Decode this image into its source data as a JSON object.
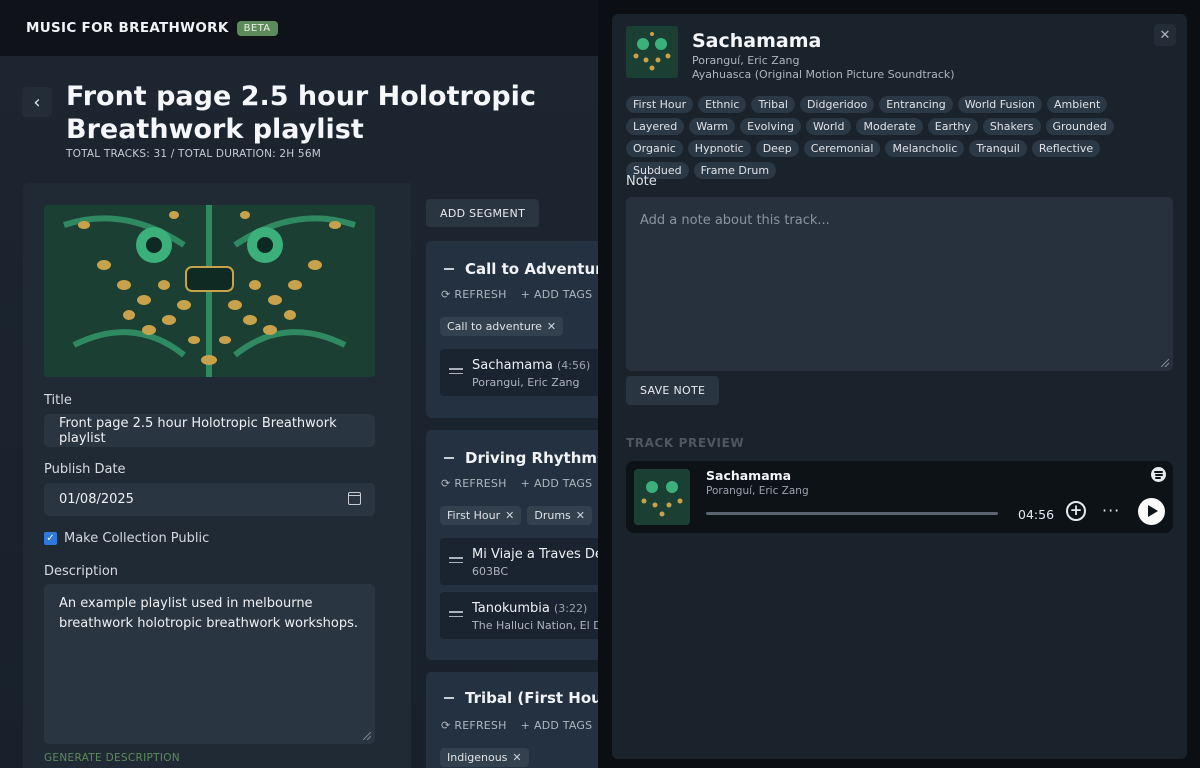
{
  "app": {
    "brand": "MUSIC FOR BREATHWORK",
    "badge": "BETA"
  },
  "page": {
    "title": "Front page 2.5 hour Holotropic Breathwork playlist",
    "meta": "TOTAL TRACKS: 31 /  TOTAL DURATION: 2H 56M"
  },
  "form": {
    "title_label": "Title",
    "title_value": "Front page 2.5 hour Holotropic Breathwork playlist",
    "date_label": "Publish Date",
    "date_value": "01/08/2025",
    "public_label": "Make Collection Public",
    "description_label": "Description",
    "description_value": "An example playlist used in melbourne breathwork holotropic breathwork workshops.",
    "generate_label": "GENERATE DESCRIPTION"
  },
  "segments": {
    "add_label": "ADD SEGMENT",
    "refresh_label": "REFRESH",
    "add_tags_label": "ADD TAGS",
    "items": [
      {
        "title": "Call to Adventure",
        "chips": [
          "Call to adventure"
        ],
        "tracks": [
          {
            "name": "Sachamama",
            "duration": "(4:56)",
            "artist": "Porangui, Eric Zang"
          }
        ]
      },
      {
        "title": "Driving Rhythms (F",
        "chips": [
          "First Hour",
          "Drums"
        ],
        "tracks": [
          {
            "name": "Mi Viaje a Traves De l",
            "duration": "",
            "artist": "603BC"
          },
          {
            "name": "Tanokumbia",
            "duration": "(3:22)",
            "artist": "The Halluci Nation, El Dus"
          }
        ]
      },
      {
        "title": "Tribal (First Hour)",
        "chips": [
          "Indigenous"
        ],
        "tracks": []
      }
    ]
  },
  "drawer": {
    "title": "Sachamama",
    "artist": "Poranguí, Eric Zang",
    "album": "Ayahuasca (Original Motion Picture Soundtrack)",
    "close_label": "✕",
    "tags": [
      "First Hour",
      "Ethnic",
      "Tribal",
      "Didgeridoo",
      "Entrancing",
      "World Fusion",
      "Ambient",
      "Layered",
      "Warm",
      "Evolving",
      "World",
      "Moderate",
      "Earthy",
      "Shakers",
      "Grounded",
      "Organic",
      "Hypnotic",
      "Deep",
      "Ceremonial",
      "Melancholic",
      "Tranquil",
      "Reflective",
      "Subdued",
      "Frame Drum"
    ],
    "note_label": "Note",
    "note_placeholder": "Add a note about this track...",
    "save_label": "SAVE NOTE",
    "preview_label": "TRACK PREVIEW",
    "player": {
      "title": "Sachamama",
      "artist": "Poranguí, Eric Zang",
      "time": "04:56",
      "progress": 0
    }
  },
  "icons": {
    "back": "chevron-left-icon",
    "refresh": "refresh-icon",
    "add": "plus-icon",
    "drag": "drag-handle-icon",
    "close": "close-icon",
    "spotify": "spotify-icon",
    "play": "play-icon",
    "more": "more-icon",
    "calendar": "calendar-icon"
  },
  "colors": {
    "accent_green": "#5d8a5a",
    "checkbox_blue": "#2f79dd",
    "bg": "#141a22",
    "cover_green": "#1f4a3a",
    "cover_gold": "#c8a24b"
  }
}
